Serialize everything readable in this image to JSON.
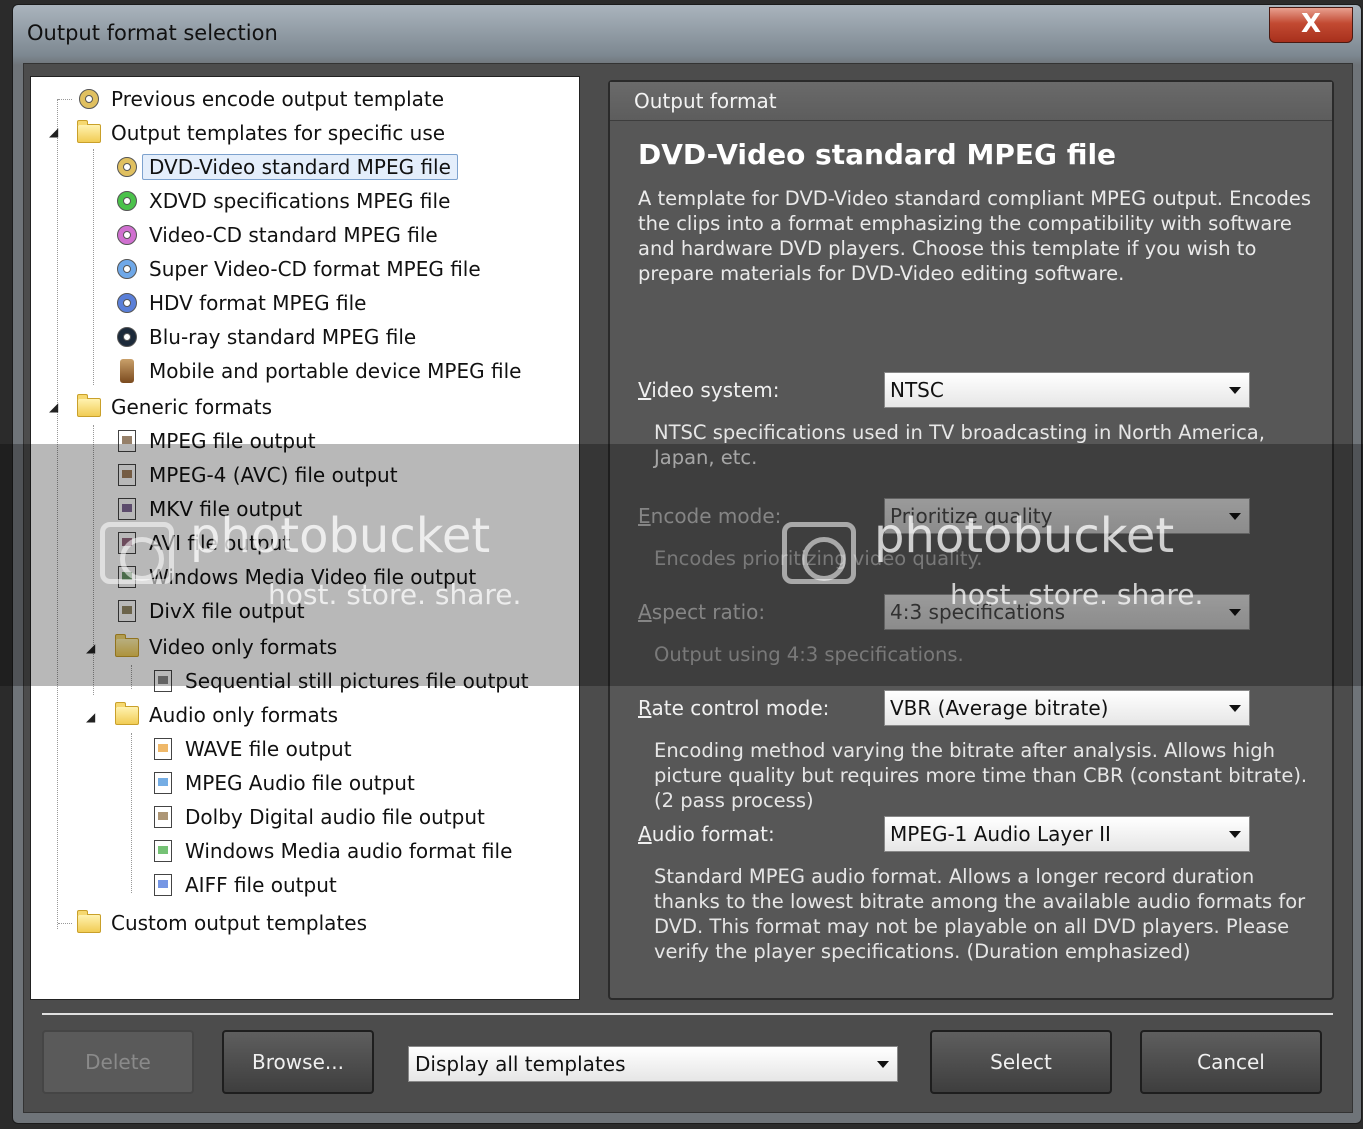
{
  "window": {
    "title": "Output format selection",
    "close_label": "X"
  },
  "tree": {
    "items": [
      {
        "label": "Previous encode output template",
        "icon": "disc-icon"
      },
      {
        "label": "Output templates for specific use",
        "icon": "folder-icon"
      },
      {
        "label": "DVD-Video standard MPEG file",
        "icon": "disc-icon",
        "selected": true
      },
      {
        "label": "XDVD specifications MPEG file",
        "icon": "disc-icon"
      },
      {
        "label": "Video-CD standard MPEG file",
        "icon": "disc-icon"
      },
      {
        "label": "Super Video-CD format MPEG file",
        "icon": "disc-icon"
      },
      {
        "label": "HDV format MPEG file",
        "icon": "disc-icon"
      },
      {
        "label": "Blu-ray standard MPEG file",
        "icon": "disc-icon"
      },
      {
        "label": "Mobile and portable device MPEG file",
        "icon": "phone-icon"
      },
      {
        "label": "Generic formats",
        "icon": "folder-icon"
      },
      {
        "label": "MPEG file output",
        "icon": "file-icon"
      },
      {
        "label": "MPEG-4 (AVC) file output",
        "icon": "file-icon"
      },
      {
        "label": "MKV file output",
        "icon": "file-icon"
      },
      {
        "label": "AVI file output",
        "icon": "file-icon"
      },
      {
        "label": "Windows Media Video file output",
        "icon": "file-icon"
      },
      {
        "label": "DivX file output",
        "icon": "file-icon"
      },
      {
        "label": "Video only formats",
        "icon": "folder-icon"
      },
      {
        "label": "Sequential still pictures file output",
        "icon": "image-file-icon"
      },
      {
        "label": "Audio only formats",
        "icon": "folder-icon"
      },
      {
        "label": "WAVE file output",
        "icon": "audio-file-icon"
      },
      {
        "label": "MPEG Audio file output",
        "icon": "audio-file-icon"
      },
      {
        "label": "Dolby Digital audio file output",
        "icon": "audio-file-icon"
      },
      {
        "label": "Windows Media audio format file",
        "icon": "audio-file-icon"
      },
      {
        "label": "AIFF file output",
        "icon": "audio-file-icon"
      },
      {
        "label": "Custom output templates",
        "icon": "folder-icon"
      }
    ]
  },
  "output": {
    "header": "Output format",
    "title": "DVD-Video standard MPEG file",
    "description": "A template for DVD-Video standard compliant MPEG output. Encodes the clips into a format emphasizing the compatibility with software and hardware DVD players. Choose this template if you wish to prepare materials for DVD-Video editing software.",
    "video_system": {
      "label_key": "V",
      "label_rest": "ideo system:",
      "value": "NTSC",
      "hint": "NTSC specifications used in TV broadcasting in North America, Japan, etc."
    },
    "encode_mode": {
      "label_key": "E",
      "label_rest": "ncode mode:",
      "value": "Prioritize quality",
      "hint": "Encodes prioritizing video quality."
    },
    "aspect_ratio": {
      "label_key": "A",
      "label_rest": "spect ratio:",
      "value": "4:3 specifications",
      "hint": "Output using 4:3 specifications."
    },
    "rate_control": {
      "label_key": "R",
      "label_rest": "ate control mode:",
      "value": "VBR (Average bitrate)",
      "hint": "Encoding method varying the bitrate after analysis. Allows high picture quality but requires more time than CBR (constant bitrate). (2 pass process)"
    },
    "audio_format": {
      "label_key": "A",
      "label_rest": "udio format:",
      "value": "MPEG-1 Audio Layer II",
      "hint": "Standard MPEG audio format. Allows a longer record duration thanks to the lowest bitrate among the available audio formats for DVD. This format may not be playable on all DVD players. Please verify the player specifications. (Duration emphasized)"
    }
  },
  "footer": {
    "delete_label": "Delete",
    "browse_label": "Browse...",
    "filter_value": "Display all templates",
    "select_label": "Select",
    "cancel_label": "Cancel"
  },
  "watermark": {
    "brand": "photobucket",
    "tagline": "host. store. share."
  }
}
